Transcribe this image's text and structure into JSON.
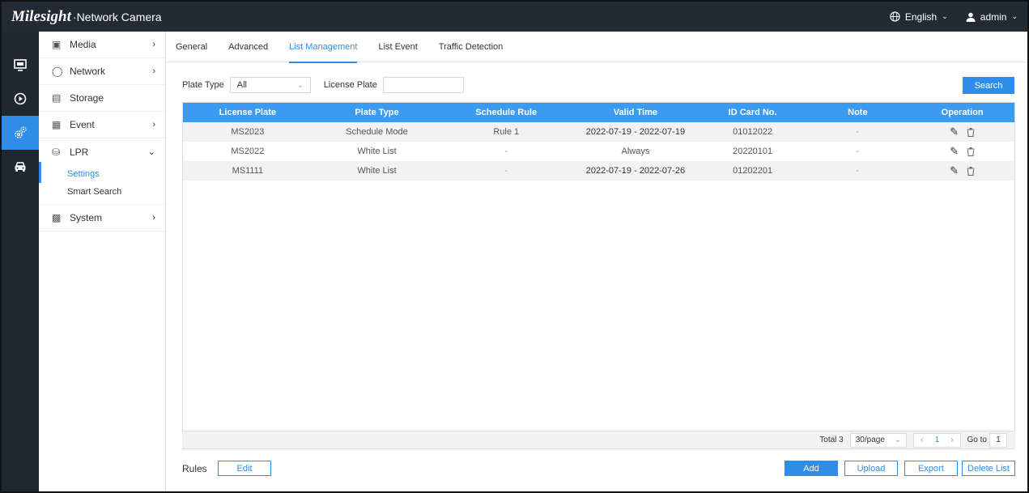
{
  "brand": {
    "logo": "Milesight",
    "product": "·Network Camera"
  },
  "header": {
    "language": "English",
    "user": "admin"
  },
  "rail": [
    {
      "name": "live-view-icon",
      "glyph": "🖥"
    },
    {
      "name": "playback-icon",
      "glyph": "⏵"
    },
    {
      "name": "settings-icon",
      "glyph": "⚙"
    },
    {
      "name": "vehicle-icon",
      "glyph": "🚘"
    }
  ],
  "menu": {
    "media": "Media",
    "network": "Network",
    "storage": "Storage",
    "event": "Event",
    "lpr": "LPR",
    "lpr_settings": "Settings",
    "lpr_smart_search": "Smart Search",
    "system": "System"
  },
  "tabs": [
    "General",
    "Advanced",
    "List Management",
    "List Event",
    "Traffic Detection"
  ],
  "active_tab": "List Management",
  "filters": {
    "plate_type_label": "Plate Type",
    "plate_type_value": "All",
    "license_plate_label": "License Plate",
    "license_plate_value": "",
    "search_label": "Search"
  },
  "table": {
    "columns": [
      "License Plate",
      "Plate Type",
      "Schedule Rule",
      "Valid Time",
      "ID Card No.",
      "Note",
      "Operation"
    ],
    "rows": [
      {
        "plate": "MS2023",
        "type": "Schedule Mode",
        "rule": "Rule 1",
        "valid": "2022-07-19 - 2022-07-19",
        "id": "01012022",
        "note": "-"
      },
      {
        "plate": "MS2022",
        "type": "White List",
        "rule": "-",
        "valid": "Always",
        "id": "20220101",
        "note": "-"
      },
      {
        "plate": "MS1111",
        "type": "White List",
        "rule": "-",
        "valid": "2022-07-19 - 2022-07-26",
        "id": "01202201",
        "note": "-"
      }
    ]
  },
  "pager": {
    "total": "Total 3",
    "per_page": "30/page",
    "page": "1",
    "goto_label": "Go to",
    "goto_value": "1"
  },
  "bottom": {
    "rules_label": "Rules",
    "edit": "Edit",
    "add": "Add",
    "upload": "Upload",
    "export": "Export",
    "delete_list": "Delete List"
  },
  "colors": {
    "accent": "#2e8de8",
    "header_bg": "#222a33",
    "table_header": "#3a9bf0"
  }
}
